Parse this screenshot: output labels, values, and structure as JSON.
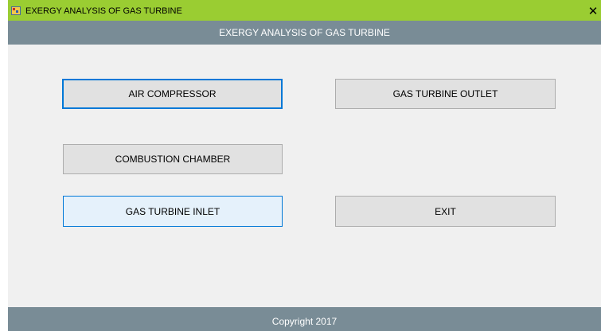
{
  "window": {
    "title": "EXERGY ANALYSIS OF GAS TURBINE",
    "close_label": "✕",
    "app_icon": "app-icon"
  },
  "header": {
    "title": "EXERGY ANALYSIS OF GAS TURBINE"
  },
  "buttons": {
    "air_compressor": "AIR COMPRESSOR",
    "gas_turbine_outlet": "GAS TURBINE OUTLET",
    "combustion_chamber": "COMBUSTION CHAMBER",
    "gas_turbine_inlet": "GAS TURBINE INLET",
    "exit": "EXIT"
  },
  "footer": {
    "copyright": "Copyright 2017"
  },
  "colors": {
    "titlebar": "#9acd32",
    "header_footer": "#798c96",
    "focus_accent": "#0078d7"
  }
}
